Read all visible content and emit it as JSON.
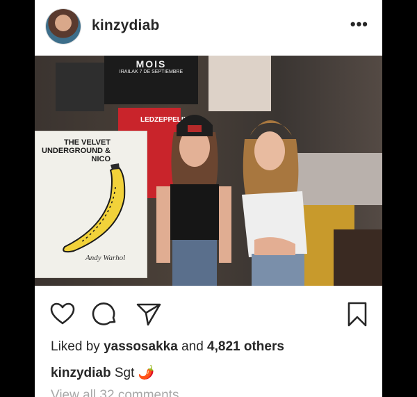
{
  "post": {
    "username": "kinzydiab",
    "more_label": "•••",
    "photo": {
      "poster_top_title": "MOIS",
      "poster_top_text": "IRAILAK 7 DE SEPTIEMBRE",
      "red_poster_text": "LEDZEPPELIN",
      "album_title": "THE VELVET UNDERGROUND & NICO",
      "album_signature": "Andy Warhol"
    },
    "likes": {
      "prefix": "Liked by",
      "user": "yassosakka",
      "middle": "and",
      "count": "4,821 others"
    },
    "caption": {
      "user": "kinzydiab",
      "text": "Sgt",
      "emoji": "🌶️"
    },
    "comments_link": "View all 32 comments"
  }
}
